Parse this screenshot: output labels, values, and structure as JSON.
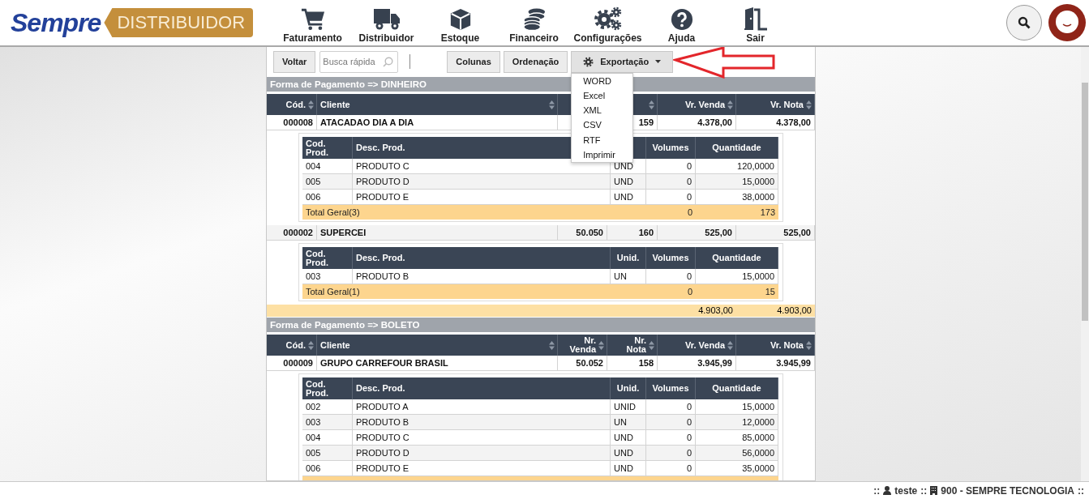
{
  "header": {
    "logo": {
      "brand": "Sempre",
      "product": "DISTRIBUIDOR"
    },
    "nav": [
      {
        "label": "Faturamento",
        "kind": "cart"
      },
      {
        "label": "Distribuidor",
        "kind": "truck"
      },
      {
        "label": "Estoque",
        "kind": "box"
      },
      {
        "label": "Financeiro",
        "kind": "coins"
      },
      {
        "label": "Configurações",
        "kind": "gears"
      },
      {
        "label": "Ajuda",
        "kind": "help"
      },
      {
        "label": "Sair",
        "kind": "door"
      }
    ]
  },
  "toolbar": {
    "back": "Voltar",
    "search": {
      "placeholder": "Busca rápida"
    },
    "buttons": [
      {
        "label": "Colunas",
        "kind": "plain"
      },
      {
        "label": "Ordenação",
        "kind": "plain"
      },
      {
        "label": "Exportação",
        "kind": "dropdown",
        "expanded": true,
        "menu": [
          "WORD",
          "Excel",
          "XML",
          "CSV",
          "RTF",
          "Imprimir"
        ]
      }
    ]
  },
  "groups": [
    {
      "title": "Forma de Pagamento => DINHEIRO",
      "columns": [
        {
          "label": "Cód."
        },
        {
          "label": "Cliente"
        },
        {},
        {
          "sortable": true
        },
        {
          "label": "Vr. Venda"
        },
        {
          "label": "Vr. Nota"
        }
      ],
      "rows": [
        {
          "cells": [
            "000008",
            "ATACADAO DIA A DIA",
            null,
            "159",
            "4.378,00",
            "4.378,00"
          ],
          "items": {
            "columns": [
              "Cod. Prod.",
              "Desc. Prod.",
              null,
              "Volumes",
              "Quantidade"
            ],
            "rows": [
              [
                "004",
                "PRODUTO C",
                "UND",
                "0",
                "120,0000"
              ],
              [
                "005",
                "PRODUTO D",
                "UND",
                "0",
                "15,0000"
              ],
              [
                "006",
                "PRODUTO E",
                "UND",
                "0",
                "38,0000"
              ]
            ],
            "total": {
              "label": "Total Geral(3)",
              "volumes": "0",
              "quantity": "173"
            }
          }
        },
        {
          "cells": [
            "000002",
            "SUPERCEI",
            "50.050",
            "160",
            "525,00",
            "525,00"
          ],
          "items": {
            "columns": [
              "Cod. Prod.",
              "Desc. Prod.",
              "Unid.",
              "Volumes",
              "Quantidade"
            ],
            "rows": [
              [
                "003",
                "PRODUTO B",
                "UN",
                "0",
                "15,0000"
              ]
            ],
            "total": {
              "label": "Total Geral(1)",
              "volumes": "0",
              "quantity": "15"
            }
          }
        }
      ],
      "totals": [
        "4.903,00",
        "4.903,00"
      ]
    },
    {
      "title": "Forma de Pagamento => BOLETO",
      "columns": [
        {
          "label": "Cód."
        },
        {
          "label": "Cliente"
        },
        {
          "label": "Nr. Venda"
        },
        {
          "label": "Nr. Nota"
        },
        {
          "label": "Vr. Venda"
        },
        {
          "label": "Vr. Nota"
        }
      ],
      "rows": [
        {
          "cells": [
            "000009",
            "GRUPO CARREFOUR BRASIL",
            "50.052",
            "158",
            "3.945,99",
            "3.945,99"
          ],
          "items": {
            "columns": [
              "Cod. Prod.",
              "Desc. Prod.",
              "Unid.",
              "Volumes",
              "Quantidade"
            ],
            "rows": [
              [
                "002",
                "PRODUTO A",
                "UNID",
                "0",
                "15,0000"
              ],
              [
                "003",
                "PRODUTO B",
                "UN",
                "0",
                "12,0000"
              ],
              [
                "004",
                "PRODUTO C",
                "UND",
                "0",
                "85,0000"
              ],
              [
                "005",
                "PRODUTO D",
                "UND",
                "0",
                "56,0000"
              ],
              [
                "006",
                "PRODUTO E",
                "UND",
                "0",
                "35,0000"
              ]
            ],
            "total_cut": true
          }
        }
      ]
    }
  ],
  "footer": {
    "separators": [
      "::",
      "::",
      "::"
    ],
    "user": "teste",
    "company": "900 - SEMPRE TECNOLOGIA"
  }
}
